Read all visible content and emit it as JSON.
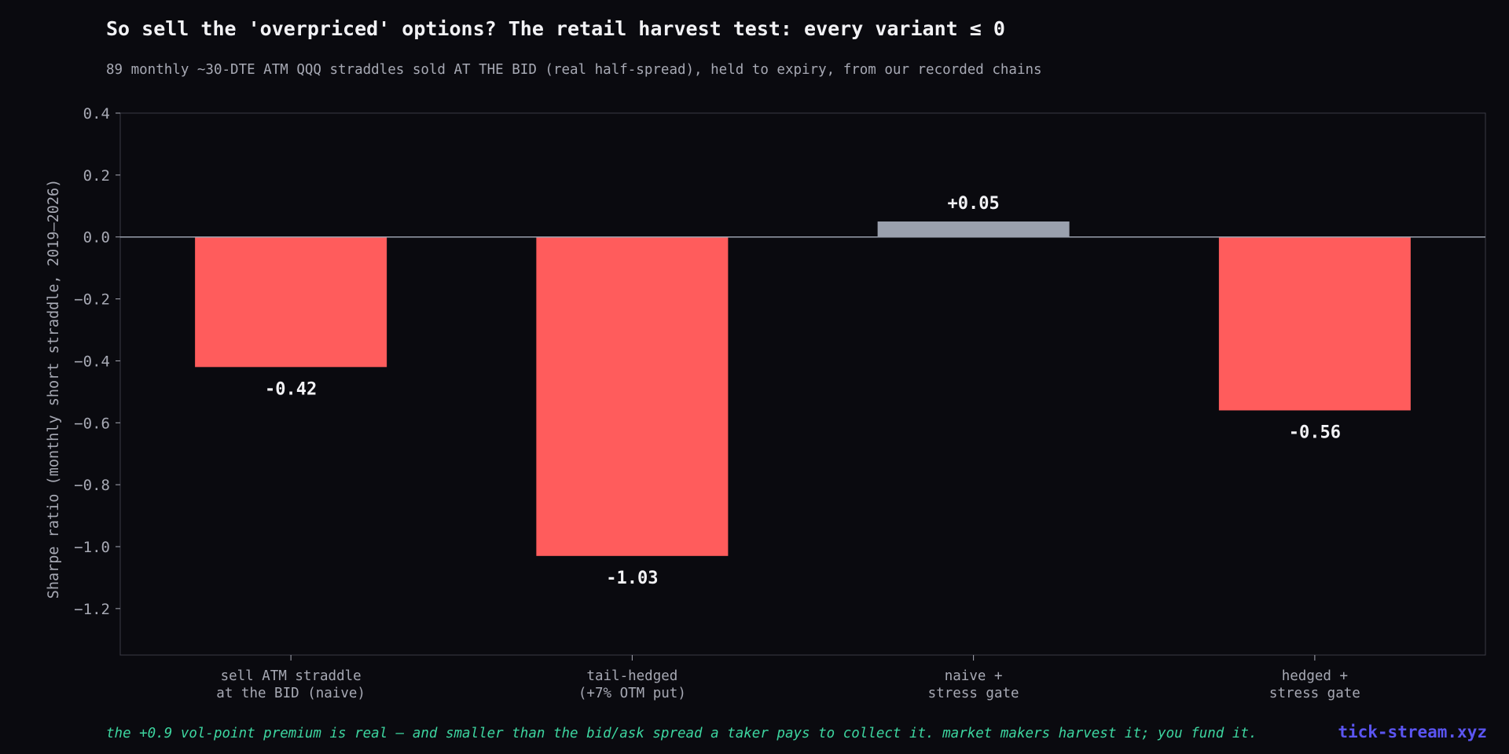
{
  "header": {
    "title": "So sell the 'overpriced' options? The retail harvest test: every variant ≤ 0",
    "subtitle": "89 monthly ~30-DTE ATM QQQ straddles sold AT THE BID (real half-spread), held to expiry, from our recorded chains"
  },
  "footer": {
    "note": "the +0.9 vol-point premium is real — and smaller than the bid/ask spread a taker pays to collect it. market makers harvest it; you fund it.",
    "brand": "tick-stream.xyz"
  },
  "colors": {
    "negative": "#ff5c5c",
    "positive": "#9aa0ad",
    "zero_line": "#9aa0ad",
    "axis": "#3a3b46",
    "tick_text": "#a7a9b4",
    "value_text": "#f2f2f5"
  },
  "chart_data": {
    "type": "bar",
    "title": "",
    "xlabel": "",
    "ylabel": "Sharpe ratio (monthly short straddle, 2019–2026)",
    "ylim": [
      -1.35,
      0.4
    ],
    "yticks": [
      0.4,
      0.2,
      0.0,
      -0.2,
      -0.4,
      -0.6,
      -0.8,
      -1.0,
      -1.2
    ],
    "ytick_labels": [
      "0.4",
      "0.2",
      "0.0",
      "−0.2",
      "−0.4",
      "−0.6",
      "−0.8",
      "−1.0",
      "−1.2"
    ],
    "grid": false,
    "categories": [
      [
        "sell ATM straddle",
        "at the BID (naive)"
      ],
      [
        "tail-hedged",
        "(+7% OTM put)"
      ],
      [
        "naive +",
        "stress gate"
      ],
      [
        "hedged +",
        "stress gate"
      ]
    ],
    "values": [
      -0.42,
      -1.03,
      0.05,
      -0.56
    ],
    "value_labels": [
      "-0.42",
      "-1.03",
      "+0.05",
      "-0.56"
    ]
  }
}
